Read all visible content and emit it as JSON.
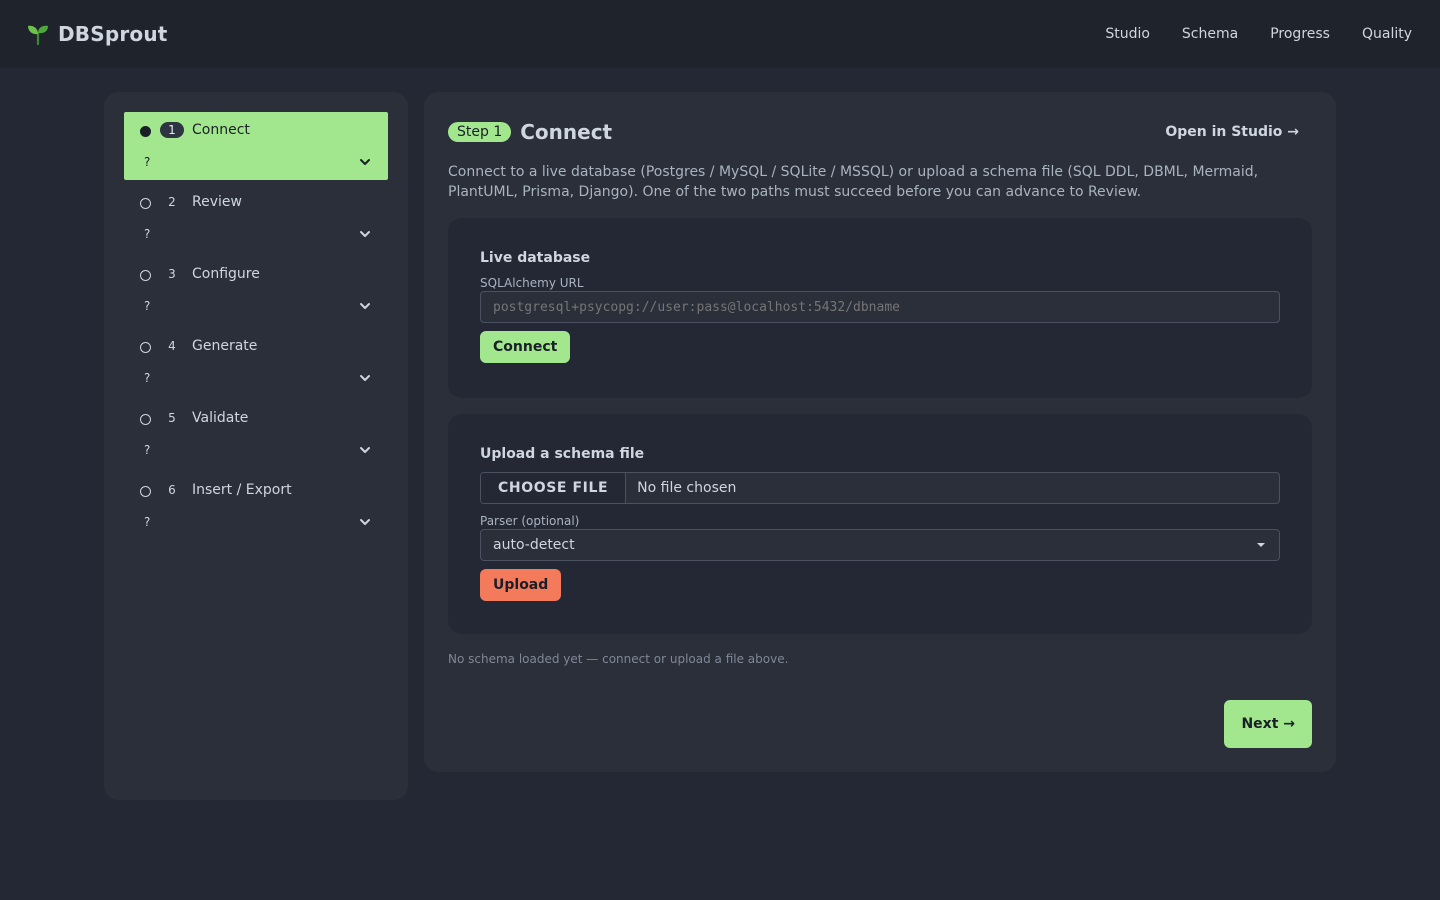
{
  "header": {
    "brand": "DBSprout",
    "brand_icon": "sprout-icon",
    "nav": [
      "Studio",
      "Schema",
      "Progress",
      "Quality"
    ]
  },
  "sidebar": {
    "steps": [
      {
        "number": "1",
        "label": "Connect",
        "hint": "?",
        "active": true
      },
      {
        "number": "2",
        "label": "Review",
        "hint": "?",
        "active": false
      },
      {
        "number": "3",
        "label": "Configure",
        "hint": "?",
        "active": false
      },
      {
        "number": "4",
        "label": "Generate",
        "hint": "?",
        "active": false
      },
      {
        "number": "5",
        "label": "Validate",
        "hint": "?",
        "active": false
      },
      {
        "number": "6",
        "label": "Insert / Export",
        "hint": "?",
        "active": false
      }
    ]
  },
  "main": {
    "step_badge": "Step 1",
    "title": "Connect",
    "open_studio": "Open in Studio →",
    "description": "Connect to a live database (Postgres / MySQL / SQLite / MSSQL) or upload a schema file (SQL DDL, DBML, Mermaid, PlantUML, Prisma, Django). One of the two paths must succeed before you can advance to Review.",
    "live_db": {
      "title": "Live database",
      "url_label": "SQLAlchemy URL",
      "url_placeholder": "postgresql+psycopg://user:pass@localhost:5432/dbname",
      "connect_label": "Connect"
    },
    "upload": {
      "title": "Upload a schema file",
      "choose_file": "CHOOSE FILE",
      "file_status": "No file chosen",
      "parser_label": "Parser (optional)",
      "parser_value": "auto-detect",
      "upload_label": "Upload"
    },
    "status_note": "No schema loaded yet — connect or upload a file above.",
    "next_label": "Next →"
  },
  "colors": {
    "accent_green": "#a2e78e",
    "accent_orange": "#f47a5c",
    "background": "#232834",
    "card": "#2a2f3a"
  }
}
